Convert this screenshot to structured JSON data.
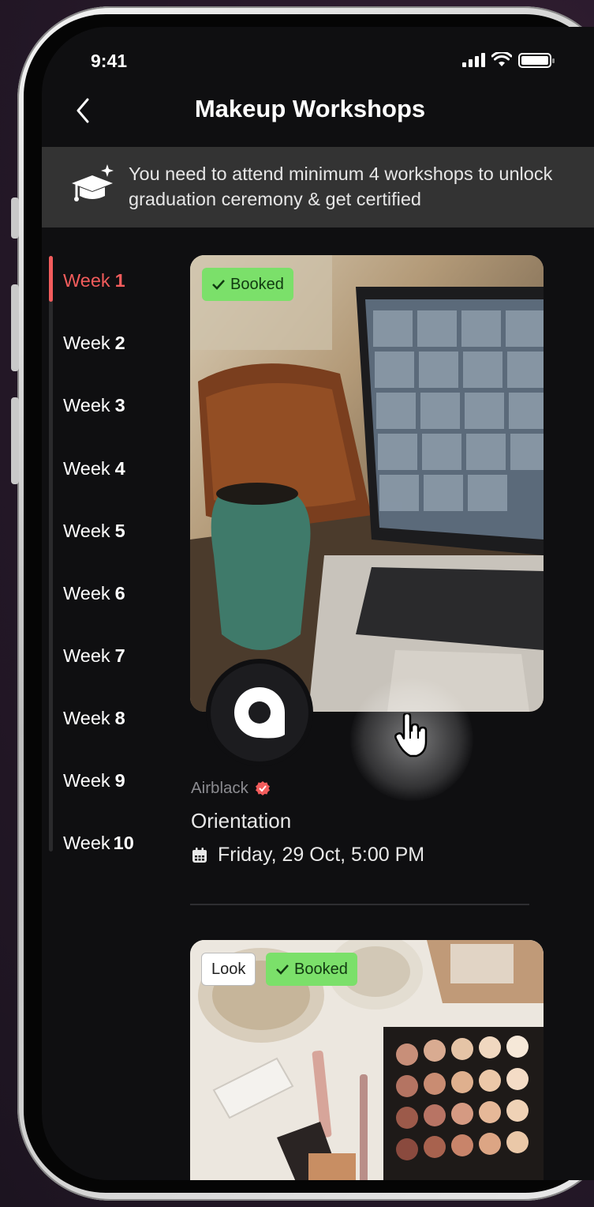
{
  "status_bar": {
    "time": "9:41"
  },
  "header": {
    "title": "Makeup Workshops"
  },
  "banner": {
    "text": "You need to attend minimum 4 workshops to unlock graduation ceremony & get certified"
  },
  "weeks": {
    "prefix": "Week",
    "items": [
      {
        "label": "Week",
        "number": "1",
        "active": true
      },
      {
        "label": "Week",
        "number": "2",
        "active": false
      },
      {
        "label": "Week",
        "number": "3",
        "active": false
      },
      {
        "label": "Week",
        "number": "4",
        "active": false
      },
      {
        "label": "Week",
        "number": "5",
        "active": false
      },
      {
        "label": "Week",
        "number": "6",
        "active": false
      },
      {
        "label": "Week",
        "number": "7",
        "active": false
      },
      {
        "label": "Week",
        "number": "8",
        "active": false
      },
      {
        "label": "Week",
        "number": "9",
        "active": false
      },
      {
        "label": "Week",
        "number": "10",
        "active": false
      }
    ]
  },
  "workshops": [
    {
      "badges": [
        "Booked"
      ],
      "host": "Airblack",
      "host_verified": true,
      "title": "Orientation",
      "date": "Friday, 29 Oct, 5:00 PM"
    },
    {
      "badges": [
        "Look",
        "Booked"
      ]
    }
  ],
  "colors": {
    "accent": "#f25c5c",
    "booked_badge": "#7be06a",
    "background": "#0f0f11",
    "banner": "#333333"
  },
  "icons": {
    "back": "chevron-left-icon",
    "graduation": "graduation-cap-icon",
    "calendar": "calendar-icon",
    "check": "check-icon",
    "verified": "verified-badge-icon",
    "cursor": "hand-pointer-icon"
  }
}
